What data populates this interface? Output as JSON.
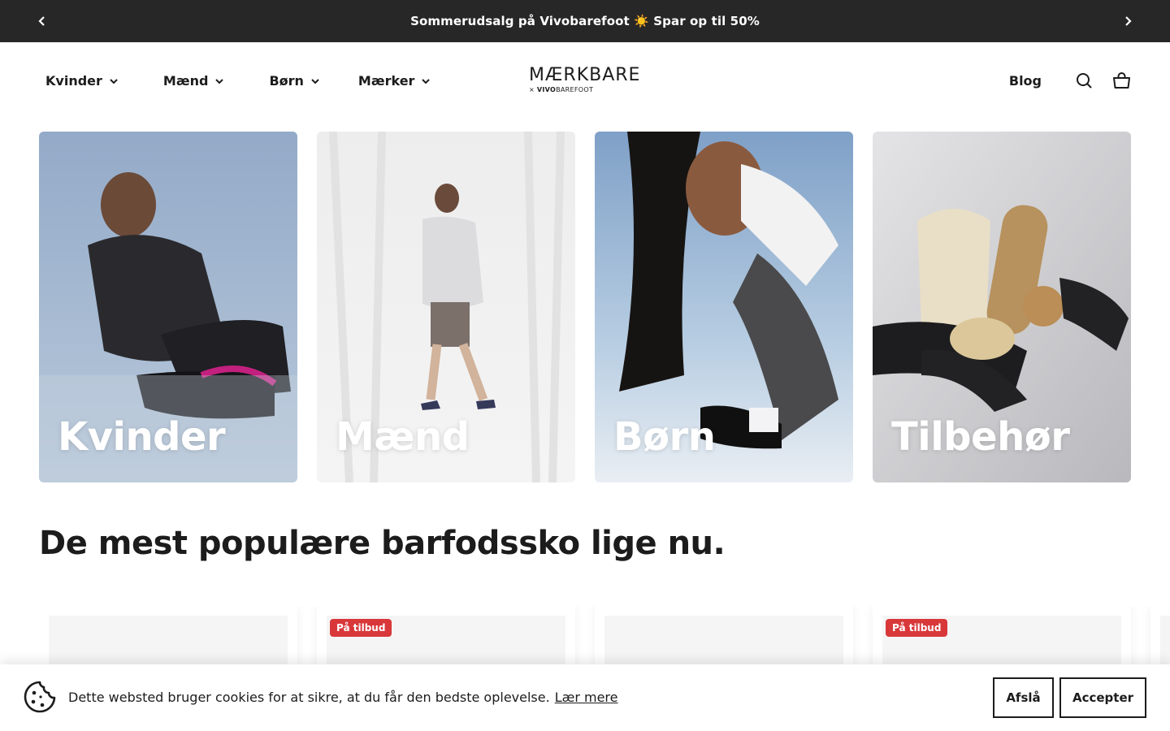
{
  "announcement": {
    "text": "Sommerudsalg på Vivobarefoot ☀️ Spar op til 50%",
    "prev_icon": "chevron-left-icon",
    "next_icon": "chevron-right-icon"
  },
  "header": {
    "nav": [
      {
        "label": "Kvinder"
      },
      {
        "label": "Mænd"
      },
      {
        "label": "Børn"
      },
      {
        "label": "Mærker"
      }
    ],
    "logo": {
      "main": "MÆRKBARE",
      "sub_prefix": "× ",
      "sub_brand": "VIVO",
      "sub_suffix": "BAREFOOT"
    },
    "blog": "Blog",
    "icons": [
      "search-icon",
      "cart-icon"
    ]
  },
  "categories": [
    {
      "label": "Kvinder"
    },
    {
      "label": "Mænd"
    },
    {
      "label": "Børn"
    },
    {
      "label": "Tilbehør"
    }
  ],
  "section": {
    "title": "De mest populære barfodssko lige nu."
  },
  "products": [
    {
      "badge": ""
    },
    {
      "badge": "På tilbud"
    },
    {
      "badge": ""
    },
    {
      "badge": "På tilbud"
    }
  ],
  "cookie": {
    "message": "Dette websted bruger cookies for at sikre, at du får den bedste oplevelse.",
    "learn_more": "Lær mere",
    "decline": "Afslå",
    "accept": "Accepter",
    "icon": "cookie-icon"
  }
}
